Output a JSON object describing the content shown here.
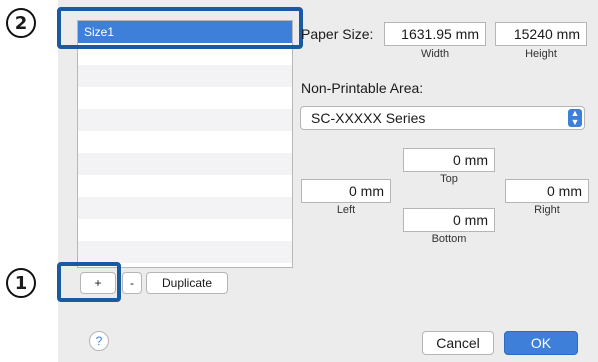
{
  "markers": {
    "one": "1",
    "two": "2"
  },
  "size_list": {
    "items": [
      "Size1",
      "",
      "",
      "",
      "",
      "",
      "",
      "",
      "",
      "",
      ""
    ]
  },
  "paper_size": {
    "label": "Paper Size:",
    "width_value": "1631.95 mm",
    "width_caption": "Width",
    "height_value": "15240 mm",
    "height_caption": "Height"
  },
  "non_printable": {
    "label": "Non-Printable Area:",
    "printer": "SC-XXXXX Series",
    "top_value": "0 mm",
    "top_caption": "Top",
    "left_value": "0 mm",
    "left_caption": "Left",
    "right_value": "0 mm",
    "right_caption": "Right",
    "bottom_value": "0 mm",
    "bottom_caption": "Bottom"
  },
  "list_buttons": {
    "add": "+",
    "remove": "-",
    "duplicate": "Duplicate"
  },
  "footer": {
    "help": "?",
    "cancel": "Cancel",
    "ok": "OK"
  },
  "colors": {
    "accent": "#3d7fd9",
    "highlight": "#1a5aa0"
  }
}
